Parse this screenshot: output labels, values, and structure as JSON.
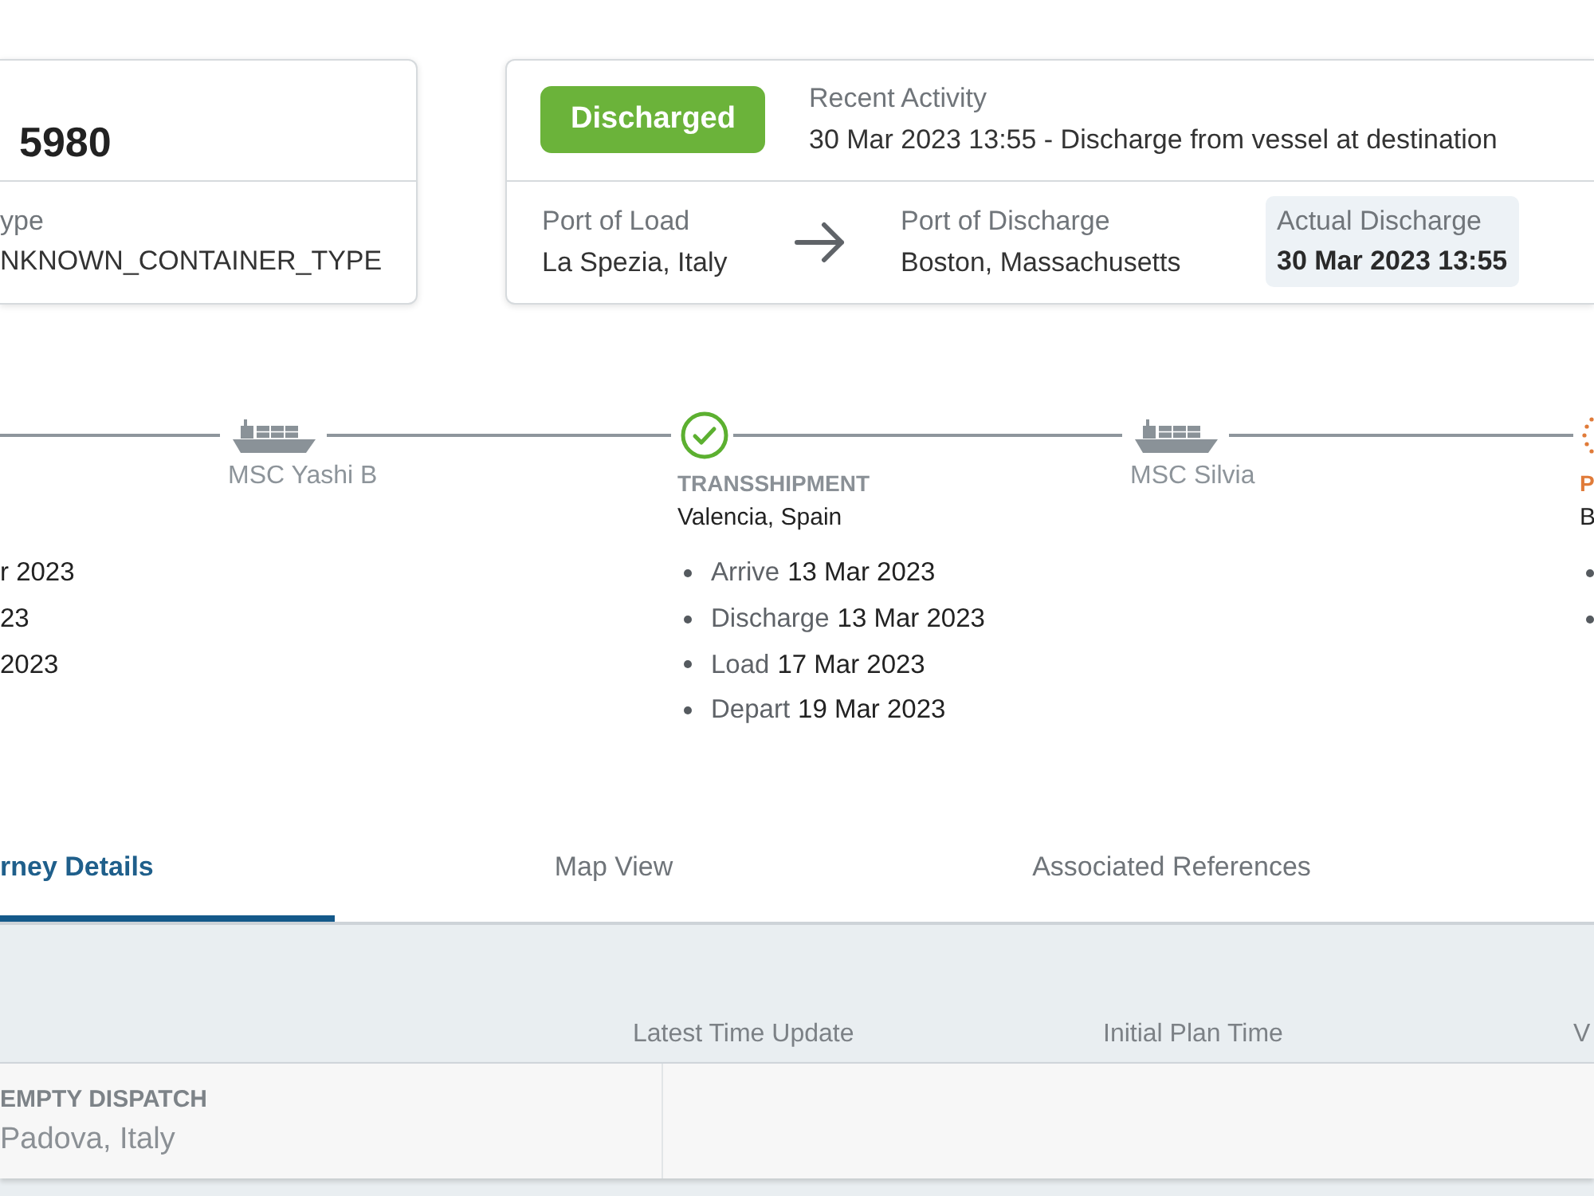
{
  "container": {
    "number": "5980",
    "type_label": "ype",
    "type_value": "NKNOWN_CONTAINER_TYPE"
  },
  "shipment": {
    "status": {
      "label": "Discharged",
      "kind": "success"
    },
    "recent_activity": {
      "label": "Recent Activity",
      "text": "30 Mar 2023 13:55 - Discharge from vessel at destination"
    },
    "port_of_load": {
      "label": "Port of Load",
      "value": "La Spezia, Italy"
    },
    "port_of_discharge": {
      "label": "Port of Discharge",
      "value": "Boston, Massachusetts"
    },
    "actual_discharge": {
      "label": "Actual Discharge",
      "value": "30 Mar 2023 13:55"
    }
  },
  "timeline": [
    {
      "kind": "stop",
      "events": [
        {
          "kind": "text",
          "date": "r 2023"
        },
        {
          "kind": "text",
          "date": "23"
        },
        {
          "kind": "text",
          "date": "2023"
        }
      ]
    },
    {
      "kind": "vessel",
      "name": "MSC Yashi B"
    },
    {
      "kind": "stop",
      "completed": true,
      "type": "TRANSSHIPMENT",
      "place": "Valencia, Spain",
      "events": [
        {
          "kind": "bullet",
          "label": "Arrive",
          "date": "13 Mar 2023"
        },
        {
          "kind": "bullet",
          "label": "Discharge",
          "date": "13 Mar 2023"
        },
        {
          "kind": "bullet",
          "label": "Load",
          "date": "17 Mar 2023"
        },
        {
          "kind": "bullet",
          "label": "Depart",
          "date": "19 Mar 2023"
        }
      ]
    },
    {
      "kind": "vessel",
      "name": "MSC Silvia"
    },
    {
      "kind": "stop",
      "completed": false,
      "type": "P",
      "place": "B",
      "events": [
        {
          "kind": "bullet"
        },
        {
          "kind": "bullet"
        }
      ]
    }
  ],
  "tabs": [
    {
      "label": "rney Details",
      "selected": true
    },
    {
      "label": "Map View",
      "selected": false
    },
    {
      "label": "Associated References",
      "selected": false
    }
  ],
  "table": {
    "columns": [
      "Latest Time Update",
      "Initial Plan Time",
      "V"
    ],
    "rows": [
      {
        "event": "EMPTY DISPATCH",
        "location": "Padova, Italy"
      }
    ]
  }
}
